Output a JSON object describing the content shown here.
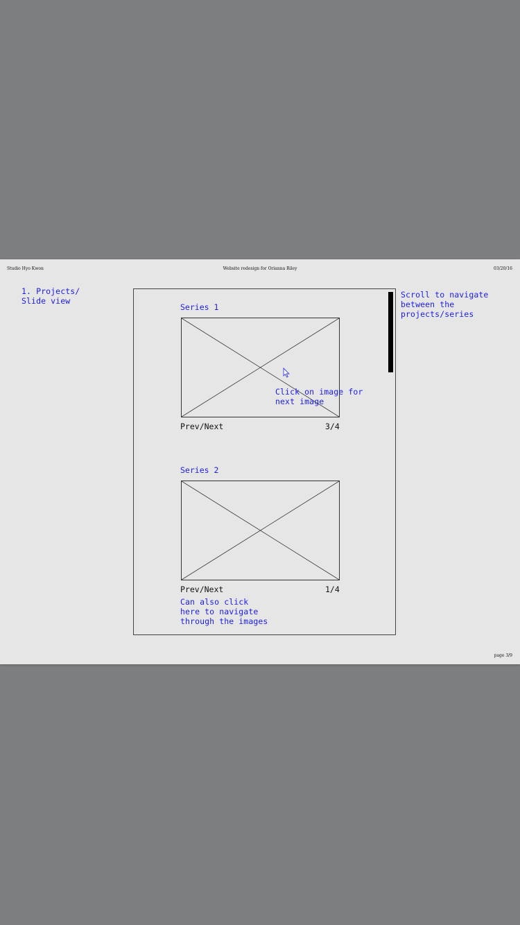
{
  "header": {
    "studio": "Studio Hyo Kwon",
    "title": "Website redesign for Orianna Riley",
    "date": "03/20/16"
  },
  "footer": {
    "page": "page 3/9"
  },
  "section_label": "1. Projects/\nSlide view",
  "scroll_note": "Scroll to navigate\nbetween the\nprojects/series",
  "click_note": "Click on image for\nnext image",
  "series": [
    {
      "title": "Series 1",
      "nav_label": "Prev/Next",
      "counter": "3/4"
    },
    {
      "title": "Series 2",
      "nav_label": "Prev/Next",
      "counter": "1/4"
    }
  ],
  "nav_note": "Can also click\nhere to navigate\nthrough the images",
  "colors": {
    "annotation": "#1c1ce6",
    "background": "#7d7e80",
    "page": "#e6e6e6"
  },
  "icons": [
    "placeholder-image-icon",
    "mouse-cursor-icon"
  ]
}
